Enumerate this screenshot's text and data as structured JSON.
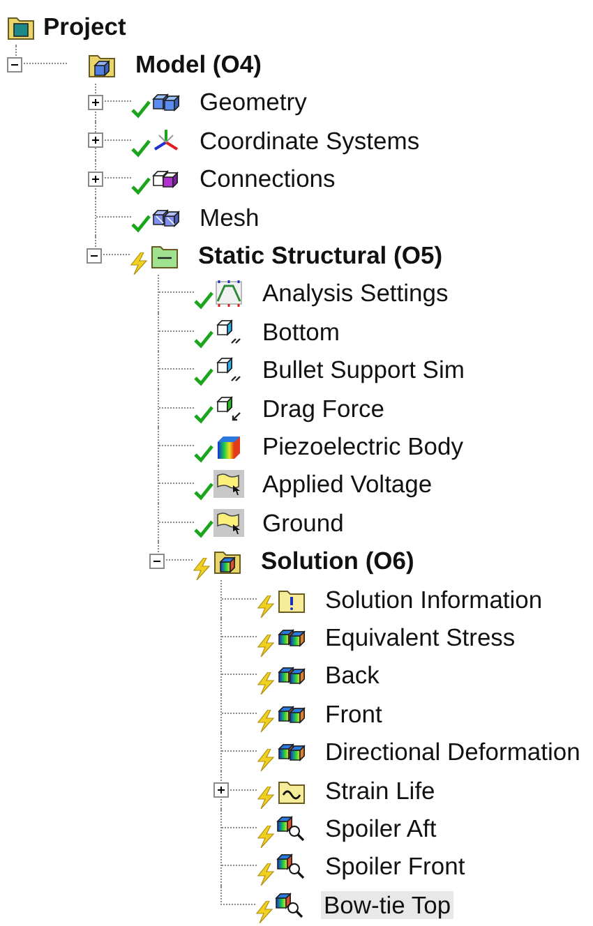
{
  "tree": {
    "label": "Project",
    "kind": "project",
    "bold": true,
    "selected": false,
    "children": [
      {
        "label": "Model (O4)",
        "kind": "model",
        "bold": true,
        "expanded": true,
        "selected": false,
        "children": [
          {
            "label": "Geometry",
            "kind": "geometry",
            "bold": false,
            "expanded": false,
            "solved": true,
            "selected": false
          },
          {
            "label": "Coordinate Systems",
            "kind": "coordinates",
            "bold": false,
            "expanded": false,
            "solved": true,
            "selected": false
          },
          {
            "label": "Connections",
            "kind": "connections",
            "bold": false,
            "expanded": false,
            "solved": true,
            "selected": false
          },
          {
            "label": "Mesh",
            "kind": "mesh",
            "bold": false,
            "solved": true,
            "selected": false
          },
          {
            "label": "Static Structural (O5)",
            "kind": "static",
            "bold": true,
            "expanded": true,
            "solved": false,
            "selected": false,
            "children": [
              {
                "label": "Analysis Settings",
                "kind": "analysis",
                "bold": false,
                "solved": true,
                "selected": false
              },
              {
                "label": "Bottom",
                "kind": "support",
                "bold": false,
                "solved": true,
                "selected": false
              },
              {
                "label": "Bullet Support Sim",
                "kind": "support",
                "bold": false,
                "solved": true,
                "selected": false
              },
              {
                "label": "Drag Force",
                "kind": "force",
                "bold": false,
                "solved": true,
                "selected": false
              },
              {
                "label": "Piezoelectric Body",
                "kind": "body",
                "bold": false,
                "solved": true,
                "selected": false
              },
              {
                "label": "Applied Voltage",
                "kind": "voltage",
                "bold": false,
                "solved": true,
                "selected": false
              },
              {
                "label": "Ground",
                "kind": "voltage",
                "bold": false,
                "solved": true,
                "selected": false
              },
              {
                "label": "Solution (O6)",
                "kind": "solution",
                "bold": true,
                "expanded": true,
                "solved": false,
                "selected": false,
                "children": [
                  {
                    "label": "Solution Information",
                    "kind": "info",
                    "bold": false,
                    "solved": false,
                    "selected": false
                  },
                  {
                    "label": "Equivalent Stress",
                    "kind": "result",
                    "bold": false,
                    "solved": false,
                    "selected": false
                  },
                  {
                    "label": "Back",
                    "kind": "result",
                    "bold": false,
                    "solved": false,
                    "selected": false
                  },
                  {
                    "label": "Front",
                    "kind": "result",
                    "bold": false,
                    "solved": false,
                    "selected": false
                  },
                  {
                    "label": "Directional Deformation",
                    "kind": "result",
                    "bold": false,
                    "solved": false,
                    "selected": false
                  },
                  {
                    "label": "Strain Life",
                    "kind": "fatigue",
                    "bold": false,
                    "expanded": false,
                    "solved": false,
                    "selected": false
                  },
                  {
                    "label": "Spoiler Aft",
                    "kind": "probe",
                    "bold": false,
                    "solved": false,
                    "selected": false
                  },
                  {
                    "label": "Spoiler Front",
                    "kind": "probe",
                    "bold": false,
                    "solved": false,
                    "selected": false
                  },
                  {
                    "label": "Bow-tie Top",
                    "kind": "probe",
                    "bold": false,
                    "solved": false,
                    "selected": true
                  }
                ]
              }
            ]
          }
        ]
      }
    ]
  }
}
